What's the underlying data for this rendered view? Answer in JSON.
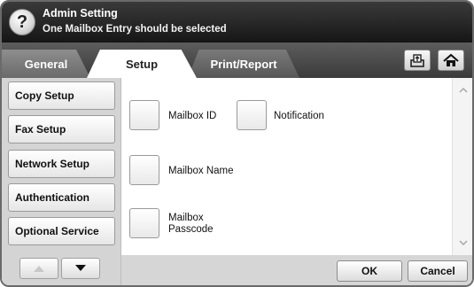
{
  "header": {
    "help_icon": "help-question-icon",
    "help_glyph": "?",
    "title": "Admin Setting",
    "subtitle": "One Mailbox Entry should be selected"
  },
  "tabs": [
    {
      "label": "General",
      "active": false
    },
    {
      "label": "Setup",
      "active": true
    },
    {
      "label": "Print/Report",
      "active": false
    }
  ],
  "toolbar": {
    "tray_icon": "paper-tray-icon",
    "home_icon": "home-icon"
  },
  "sidebar": {
    "items": [
      {
        "label": "Copy Setup"
      },
      {
        "label": "Fax Setup"
      },
      {
        "label": "Network Setup"
      },
      {
        "label": "Authentication"
      },
      {
        "label": "Optional Service"
      }
    ],
    "up_icon": "arrow-up-icon",
    "down_icon": "arrow-down-icon"
  },
  "options": [
    {
      "label": "Mailbox ID"
    },
    {
      "label": "Notification"
    },
    {
      "label": "Mailbox Name"
    },
    {
      "label_line1": "Mailbox",
      "label_line2": "Passcode"
    }
  ],
  "footer": {
    "ok_label": "OK",
    "cancel_label": "Cancel"
  },
  "colors": {
    "header_bg": "#1f1f1f",
    "tab_bar_bg": "#4a4a4a",
    "panel_bg": "#d9d9d9"
  }
}
